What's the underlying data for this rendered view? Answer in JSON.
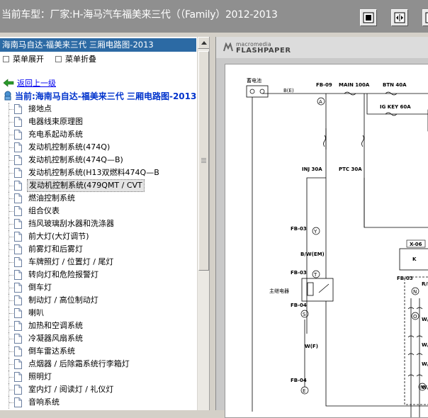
{
  "title_bar": {
    "title": "当前车型：厂家:H-海马汽车福美来三代（（Family）2012-2013"
  },
  "left_panel": {
    "selected_header": "海南马自达-福美来三代 三厢电路图-2013",
    "menu_expand": "菜单展开",
    "menu_collapse": "菜单折叠",
    "back_link": "返回上一级",
    "current_label": "当前:海南马自达-福美来三代 三厢电路图-2013",
    "items": [
      {
        "label": "接地点"
      },
      {
        "label": "电器线束原理图"
      },
      {
        "label": "充电系起动系统"
      },
      {
        "label": "发动机控制系统(474Q)"
      },
      {
        "label": "发动机控制系统(474Q—B)"
      },
      {
        "label": "发动机控制系统(H13双燃料474Q—B"
      },
      {
        "label": "发动机控制系统(479QMT / CVT"
      },
      {
        "label": "燃油控制系统"
      },
      {
        "label": "组合仪表"
      },
      {
        "label": "挡风玻璃刮水器和洗涤器"
      },
      {
        "label": "前大灯(大灯调节)"
      },
      {
        "label": "前雾灯和后雾灯"
      },
      {
        "label": "车牌照灯 / 位置灯 / 尾灯"
      },
      {
        "label": "转向灯和危险报警灯"
      },
      {
        "label": "倒车灯"
      },
      {
        "label": "制动灯 / 高位制动灯"
      },
      {
        "label": "喇叭"
      },
      {
        "label": "加热和空调系统"
      },
      {
        "label": "冷凝器风扇系统"
      },
      {
        "label": "倒车雷达系统"
      },
      {
        "label": "点烟器 / 后除霜系统行李箱灯"
      },
      {
        "label": "照明灯"
      },
      {
        "label": "室内灯 / 阅读灯 / 礼仪灯"
      },
      {
        "label": "音响系统"
      }
    ],
    "selected_index": 6
  },
  "viewer": {
    "logo_top": "macromedia",
    "logo_main": "FLASHPAPER",
    "diagram": {
      "battery": "蓄电池",
      "b_e": "B(E)",
      "fb09": "FB-09",
      "a": "A",
      "main": "MAIN 100A",
      "btn": "BTN 40A",
      "igkey": "IG KEY 60A",
      "inj": "INJ 30A",
      "ptc": "PTC 30A",
      "x06": "X-06",
      "k": "K",
      "fb03a": "FB-03",
      "y": "Y",
      "bwem": "B/W(EM)",
      "fb03b": "FB-03",
      "t": "T",
      "main_relay": "主继电器",
      "fb04a": "FB-04",
      "s": "S",
      "wf": "W(F)",
      "fb04b": "FB-04",
      "e": "E",
      "fb03c": "FB-03",
      "n": "N",
      "o": "O",
      "m": "M",
      "r_n": "R/N",
      "w1": "W/",
      "w2": "W/",
      "w3": "W/",
      "w4": "W/"
    }
  },
  "colors": {
    "titlebar": "#8f8f8f",
    "selection": "#2c6aa4",
    "link": "#0000ee",
    "current": "#0033cc"
  }
}
